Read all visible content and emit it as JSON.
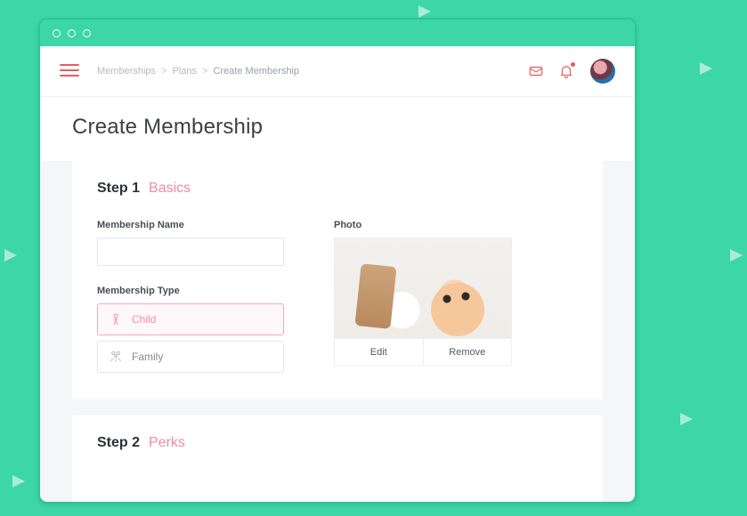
{
  "breadcrumb": {
    "a": "Memberships",
    "b": "Plans",
    "c": "Create Membership"
  },
  "page_title": "Create Membership",
  "step1": {
    "num": "Step 1",
    "name": "Basics",
    "membership_name_label": "Membership Name",
    "membership_name_value": "",
    "membership_type_label": "Membership Type",
    "type_child": "Child",
    "type_family": "Family",
    "photo_label": "Photo",
    "edit": "Edit",
    "remove": "Remove"
  },
  "step2": {
    "num": "Step 2",
    "name": "Perks"
  },
  "colors": {
    "accent": "#ec5b5b",
    "pink": "#f08aa5",
    "bg": "#3dd6a5"
  }
}
